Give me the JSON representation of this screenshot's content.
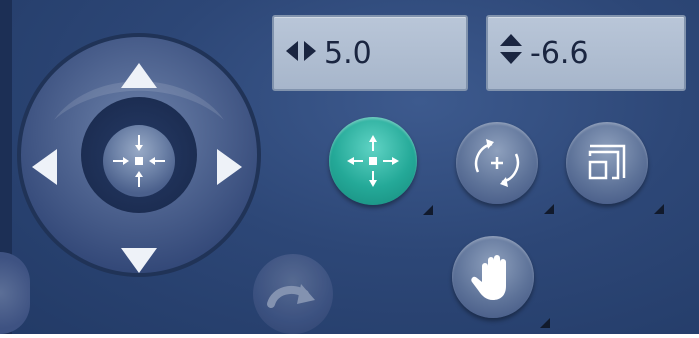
{
  "readouts": {
    "horizontal": {
      "icon": "left-right-arrows-icon",
      "value": "5.0"
    },
    "vertical": {
      "icon": "up-down-arrows-icon",
      "value": "-6.6"
    }
  },
  "pad": {
    "up": "arrow-up-icon",
    "down": "arrow-down-icon",
    "left": "arrow-left-icon",
    "right": "arrow-right-icon",
    "center": "center-icon"
  },
  "buttons": {
    "move": {
      "icon": "move-icon",
      "active": true
    },
    "rotate": {
      "icon": "rotate-icon"
    },
    "scale": {
      "icon": "scale-icon"
    },
    "hand": {
      "icon": "hand-icon"
    },
    "redo": {
      "icon": "redo-icon"
    }
  },
  "colors": {
    "background": "#2d4777",
    "active_button": "#24a998",
    "readout_bg": "#b1bfd2",
    "readout_text": "#1a2540"
  }
}
